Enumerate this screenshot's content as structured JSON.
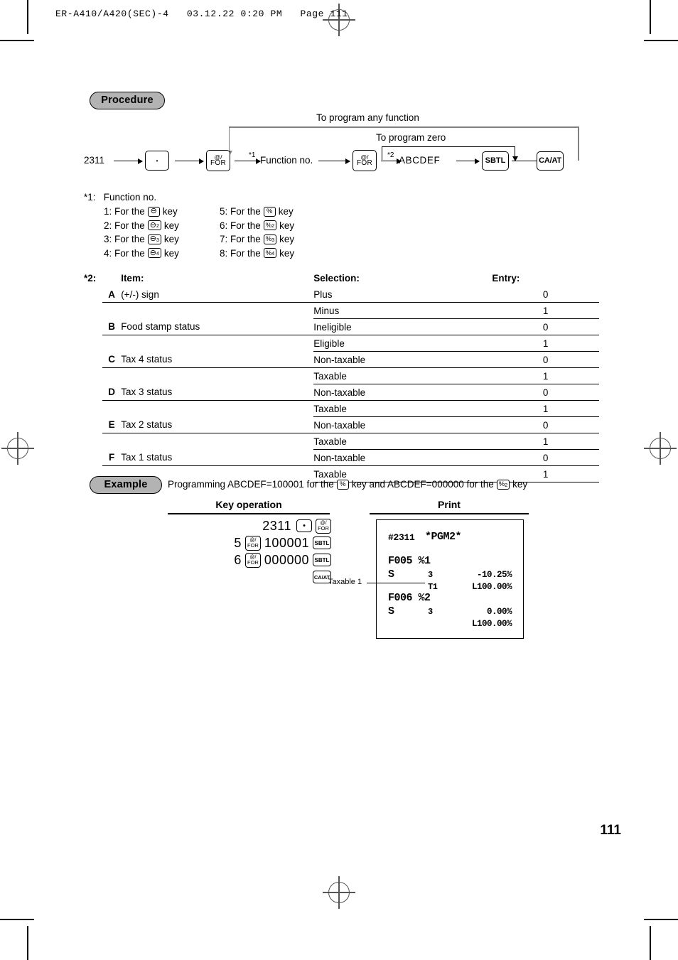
{
  "file_header": "ER-A410/A420(SEC)-4   03.12.22 0:20 PM   Page 111",
  "page_number": "111",
  "procedure": {
    "badge": "Procedure",
    "start_code": "2311",
    "label_any_function": "To program any function",
    "label_program_zero": "To program zero",
    "note1_marker": "*1",
    "function_no_label": "Function no.",
    "note2_marker": "*2",
    "abcdef_label": "ABCDEF",
    "keys": {
      "dot": "•",
      "for_l1": "@/",
      "for_l2": "FOR",
      "sbtl": "SBTL",
      "caat": "CA/AT"
    }
  },
  "funcno": {
    "marker": "*1:",
    "title": "Function no.",
    "rows": [
      {
        "left_num": "1: For the",
        "left_key": "⊖",
        "left_key_sub": "",
        "left_tail": "key",
        "right_num": "5: For the",
        "right_key": "%",
        "right_key_sub": "",
        "right_tail": "key"
      },
      {
        "left_num": "2: For the",
        "left_key": "⊖",
        "left_key_sub": "2",
        "left_tail": "key",
        "right_num": "6: For the",
        "right_key": "%",
        "right_key_sub": "2",
        "right_tail": "key"
      },
      {
        "left_num": "3: For the",
        "left_key": "⊖",
        "left_key_sub": "3",
        "left_tail": "key",
        "right_num": "7: For the",
        "right_key": "%",
        "right_key_sub": "3",
        "right_tail": "key"
      },
      {
        "left_num": "4: For the",
        "left_key": "⊖",
        "left_key_sub": "4",
        "left_tail": "key",
        "right_num": "8: For the",
        "right_key": "%",
        "right_key_sub": "4",
        "right_tail": "key"
      }
    ]
  },
  "item_table": {
    "marker": "*2:",
    "headers": {
      "item": "Item:",
      "selection": "Selection:",
      "entry": "Entry:"
    },
    "rows": [
      {
        "letter": "A",
        "item": "(+/-) sign",
        "sel1": "Plus",
        "entry1": "0",
        "sel2": "Minus",
        "entry2": "1"
      },
      {
        "letter": "B",
        "item": "Food stamp status",
        "sel1": "Ineligible",
        "entry1": "0",
        "sel2": "Eligible",
        "entry2": "1"
      },
      {
        "letter": "C",
        "item": "Tax 4 status",
        "sel1": "Non-taxable",
        "entry1": "0",
        "sel2": "Taxable",
        "entry2": "1"
      },
      {
        "letter": "D",
        "item": "Tax 3 status",
        "sel1": "Non-taxable",
        "entry1": "0",
        "sel2": "Taxable",
        "entry2": "1"
      },
      {
        "letter": "E",
        "item": "Tax 2 status",
        "sel1": "Non-taxable",
        "entry1": "0",
        "sel2": "Taxable",
        "entry2": "1"
      },
      {
        "letter": "F",
        "item": "Tax 1 status",
        "sel1": "Non-taxable",
        "entry1": "0",
        "sel2": "Taxable",
        "entry2": "1"
      }
    ]
  },
  "example": {
    "badge": "Example",
    "text_a": "Programming ABCDEF=100001 for the",
    "key_a": "%",
    "key_a_sub": "",
    "text_b": "key and ABCDEF=000000 for the",
    "key_b": "%",
    "key_b_sub": "2",
    "text_c": "key",
    "col_keyop": "Key operation",
    "col_print": "Print",
    "keyop_rows": [
      {
        "num": "2311",
        "keys": [
          "dot",
          "for"
        ]
      },
      {
        "num": "5",
        "mid": "100001",
        "keys": [
          "for",
          "sbtl"
        ]
      },
      {
        "num": "6",
        "mid": "000000",
        "keys": [
          "for",
          "sbtl"
        ]
      },
      {
        "num": "",
        "keys": [
          "caat"
        ]
      }
    ],
    "callout": "Taxable 1"
  },
  "receipt": {
    "header_left": "#2311",
    "header_right": "*PGM2*",
    "line_f005": "F005 %1",
    "line_s1_label": "S",
    "line_s1_val": "3",
    "line_s1_amt": "-10.25%",
    "line_t1": "T1",
    "line_t1_amt": "L100.00%",
    "line_f006": "F006 %2",
    "line_s2_label": "S",
    "line_s2_val": "3",
    "line_s2_amt": "0.00%",
    "line_l2_amt": "L100.00%"
  }
}
